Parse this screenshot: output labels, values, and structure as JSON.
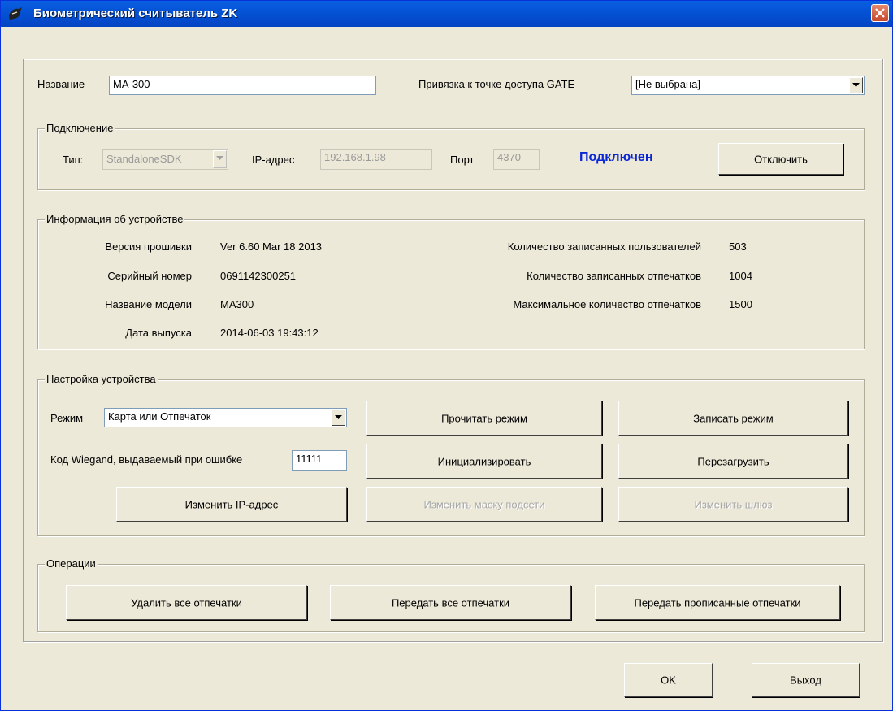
{
  "window": {
    "title": "Биометрический считыватель ZK"
  },
  "header": {
    "name_label": "Название",
    "name_value": "MA-300",
    "gate_label": "Привязка к точке доступа GATE",
    "gate_value": "[Не выбрана]"
  },
  "connection": {
    "title": "Подключение",
    "type_label": "Тип:",
    "type_value": "StandaloneSDK",
    "ip_label": "IP-адрес",
    "ip_value": "192.168.1.98",
    "port_label": "Порт",
    "port_value": "4370",
    "status": "Подключен",
    "disconnect_label": "Отключить"
  },
  "device_info": {
    "title": "Информация об устройстве",
    "left": [
      {
        "label": "Версия прошивки",
        "value": "Ver 6.60 Mar 18 2013"
      },
      {
        "label": "Серийный номер",
        "value": "0691142300251"
      },
      {
        "label": "Название модели",
        "value": "MA300"
      },
      {
        "label": "Дата выпуска",
        "value": "2014-06-03 19:43:12"
      }
    ],
    "right": [
      {
        "label": "Количество записанных пользователей",
        "value": "503"
      },
      {
        "label": "Количество записанных отпечатков",
        "value": "1004"
      },
      {
        "label": "Максимальное количество отпечатков",
        "value": "1500"
      }
    ]
  },
  "settings": {
    "title": "Настройка устройства",
    "mode_label": "Режим",
    "mode_value": "Карта или Отпечаток",
    "wiegand_label": "Код Wiegand, выдаваемый при ошибке",
    "wiegand_value": "11111",
    "read_mode": "Прочитать режим",
    "write_mode": "Записать режим",
    "initialize": "Инициализировать",
    "reboot": "Перезагрузить",
    "change_ip": "Изменить IP-адрес",
    "change_mask": "Изменить маску подсети",
    "change_gateway": "Изменить шлюз"
  },
  "operations": {
    "title": "Операции",
    "delete_all": "Удалить все отпечатки",
    "transfer_all": "Передать все отпечатки",
    "transfer_assigned": "Передать прописанные отпечатки"
  },
  "footer": {
    "ok": "OK",
    "exit": "Выход"
  },
  "colors": {
    "title_bar": "#0553d6",
    "status_connected": "#0a27d6",
    "dialog_bg": "#ece9d8"
  }
}
